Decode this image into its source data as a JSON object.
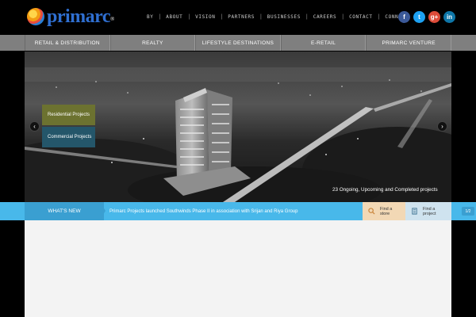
{
  "header": {
    "logo_text": "primarc",
    "logo_mark": "®",
    "topnav": [
      "BY",
      "ABOUT",
      "VISION",
      "PARTNERS",
      "BUSINESSES",
      "CAREERS",
      "CONTACT",
      "CONNECT"
    ],
    "social": [
      {
        "icon": "facebook-icon",
        "glyph": "f",
        "color": "#3b5998"
      },
      {
        "icon": "twitter-icon",
        "glyph": "t",
        "color": "#1da1f2"
      },
      {
        "icon": "googleplus-icon",
        "glyph": "g+",
        "color": "#dd4b39"
      },
      {
        "icon": "linkedin-icon",
        "glyph": "in",
        "color": "#0e76a8"
      }
    ]
  },
  "mainnav": {
    "items": [
      "RETAIL & DISTRIBUTION",
      "REALTY",
      "LIFESTYLE DESTINATIONS",
      "E-RETAIL",
      "PRIMARC VENTURE"
    ]
  },
  "hero": {
    "prev_glyph": "‹",
    "next_glyph": "›",
    "residential_label": "Residential Projects",
    "commercial_label": "Commercial Projects",
    "caption": "23 Ongoing, Upcoming and Completed projects",
    "residential_color": "#6c7230",
    "commercial_color": "#24566a"
  },
  "newsbar": {
    "whats_new_label": "WHAT'S NEW",
    "news_text": "Primarc Projects launched  Southwinds Phase II in association with Srijan and Riya Group",
    "find_store_label": "Find a store",
    "find_project_label": "Find a project",
    "pager": "1/2",
    "accent": "#48b8ea"
  }
}
